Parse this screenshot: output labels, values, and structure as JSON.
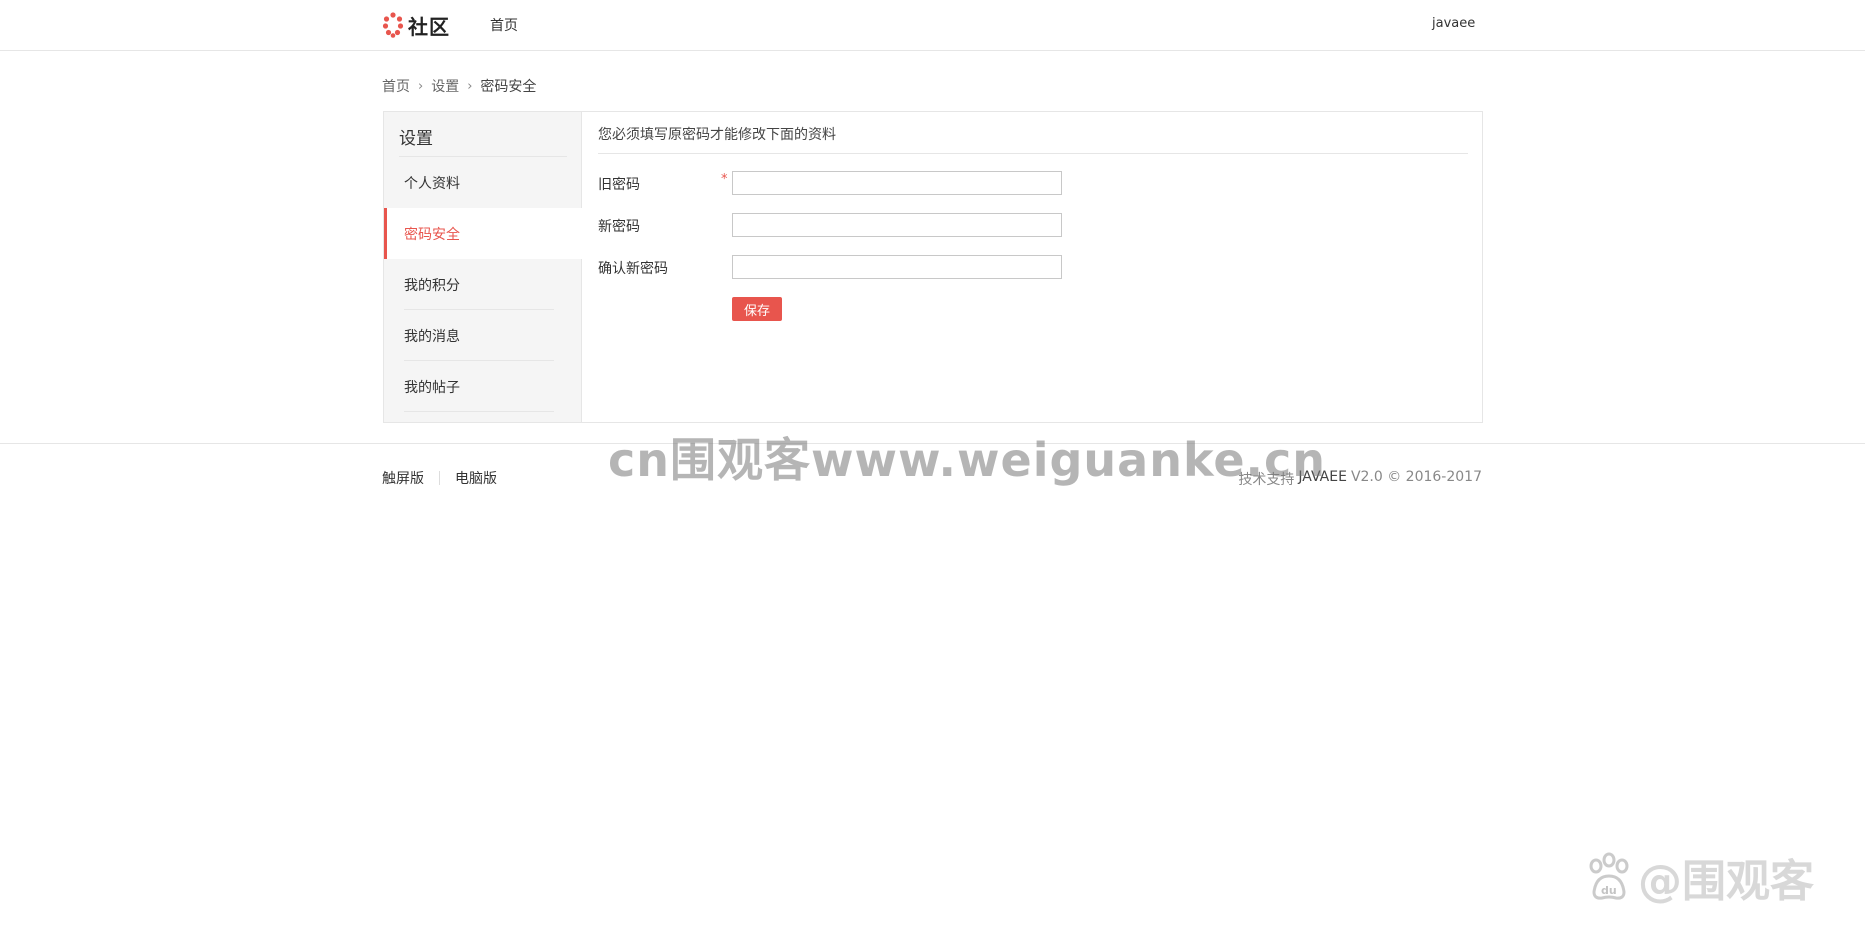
{
  "header": {
    "logo_text": "社区",
    "nav_home": "首页",
    "username": "javaee"
  },
  "breadcrumb": {
    "items": [
      "首页",
      "设置",
      "密码安全"
    ]
  },
  "sidebar": {
    "title": "设置",
    "items": [
      {
        "label": "个人资料",
        "active": false
      },
      {
        "label": "密码安全",
        "active": true
      },
      {
        "label": "我的积分",
        "active": false
      },
      {
        "label": "我的消息",
        "active": false
      },
      {
        "label": "我的帖子",
        "active": false
      }
    ]
  },
  "form": {
    "notice": "您必须填写原密码才能修改下面的资料",
    "old_password_label": "旧密码",
    "required_mark": "*",
    "new_password_label": "新密码",
    "confirm_password_label": "确认新密码",
    "old_password_value": "",
    "new_password_value": "",
    "confirm_password_value": "",
    "save_label": "保存"
  },
  "footer": {
    "links": [
      "触屏版",
      "电脑版"
    ],
    "support_text": "技术支持",
    "brand": "JAVAEE",
    "version_text": "V2.0 © 2016-2017"
  },
  "watermarks": {
    "center": "cn围观客www.weiguanke.cn",
    "corner": "@围观客"
  },
  "colors": {
    "accent": "#e8554d",
    "sidebar_bg": "#f5f5f5",
    "border": "#e6e6e6"
  }
}
